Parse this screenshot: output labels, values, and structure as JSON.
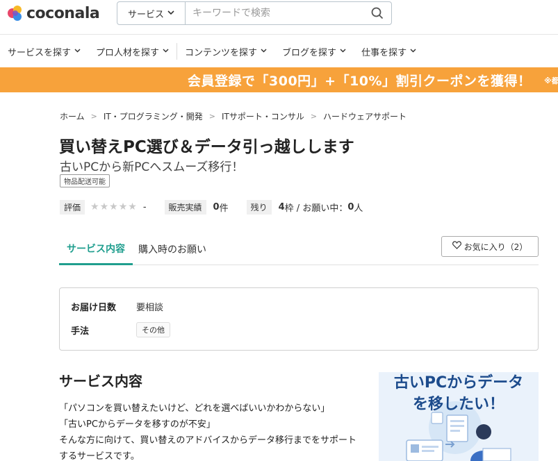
{
  "header": {
    "logo_text": "coconala",
    "search_category": "サービス",
    "search_placeholder": "キーワードで検索"
  },
  "nav": {
    "items": [
      "サービスを探す",
      "プロ人材を探す",
      "コンテンツを探す",
      "ブログを探す",
      "仕事を探す"
    ]
  },
  "banner": {
    "text": "会員登録で「300円」+「10%」割引クーポンを獲得！",
    "note": "※都"
  },
  "breadcrumb": [
    "ホーム",
    "IT・プログラミング・開発",
    "ITサポート・コンサル",
    "ハードウェアサポート"
  ],
  "service": {
    "title": "買い替えPC選び＆データ引っ越しします",
    "subtitle": "古いPCから新PCへスムーズ移行！",
    "tag": "物品配送可能"
  },
  "stats": {
    "rating_label": "評価",
    "rating_value": "-",
    "sales_label": "販売実績",
    "sales_value": "0",
    "sales_unit": "件",
    "remaining_label": "残り",
    "remaining_value": "4",
    "remaining_unit": "枠 / お願い中：",
    "requesting_value": "0",
    "requesting_unit": "人"
  },
  "tabs": {
    "active": "サービス内容",
    "second": "購入時のお願い",
    "favorite": "お気に入り（2）"
  },
  "info": {
    "delivery_label": "お届け日数",
    "delivery_value": "要相談",
    "method_label": "手法",
    "method_value": "その他"
  },
  "content": {
    "heading": "サービス内容",
    "line1": "「パソコンを買い替えたいけど、どれを選べばいいかわからない」",
    "line2": "「古いPCからデータを移すのが不安」",
    "line3": "そんな方に向けて、買い替えのアドバイスからデータ移行までをサポートするサービスです。"
  },
  "thumbnail": {
    "caption_line1": "古いPCからデータ",
    "caption_line2": "を移したい！"
  },
  "colors": {
    "accent": "#1f9e8e",
    "banner": "#f7a23b",
    "thumbnail_text": "#1c4b8c"
  }
}
